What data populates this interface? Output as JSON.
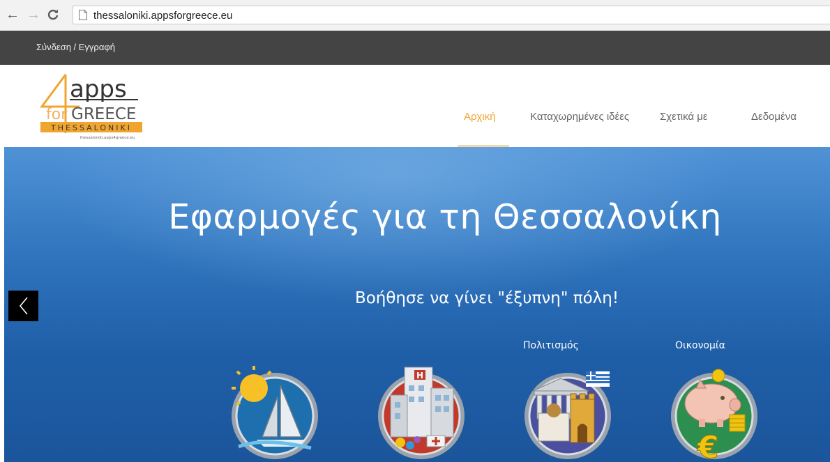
{
  "browser": {
    "back_icon": "arrow-left-icon",
    "forward_icon": "arrow-right-icon",
    "reload_icon": "reload-icon",
    "url": "thessaloniki.appsforgreece.eu"
  },
  "topbar": {
    "login_label": "Σύνδεση / Εγγραφή"
  },
  "logo": {
    "big": "apps",
    "numeral": "4",
    "for": "for",
    "greece": "GREECE",
    "city": "THESSALONIKI",
    "small": "thessaloniki.apps4greece.eu"
  },
  "nav": {
    "items": [
      {
        "label": "Αρχική",
        "active": true
      },
      {
        "label": "Καταχωρημένες ιδέες"
      },
      {
        "label": "Σχετικά με"
      },
      {
        "label": "Δεδομένα"
      }
    ]
  },
  "hero": {
    "title": "Εφαρμογές για τη Θεσσαλονίκη",
    "subtitle": "Βοήθησε να γίνει \"έξυπνη\" πόλη!",
    "categories": [
      {
        "label": "",
        "icon": "sailboat-sun-icon"
      },
      {
        "label": "",
        "icon": "hospital-icon"
      },
      {
        "label": "Πολιτισμός",
        "icon": "culture-monuments-icon"
      },
      {
        "label": "Οικονομία",
        "icon": "piggy-bank-euro-icon"
      }
    ]
  },
  "colors": {
    "accent": "#f0a530",
    "topbar": "#444444",
    "hero": "#2f74bd"
  }
}
